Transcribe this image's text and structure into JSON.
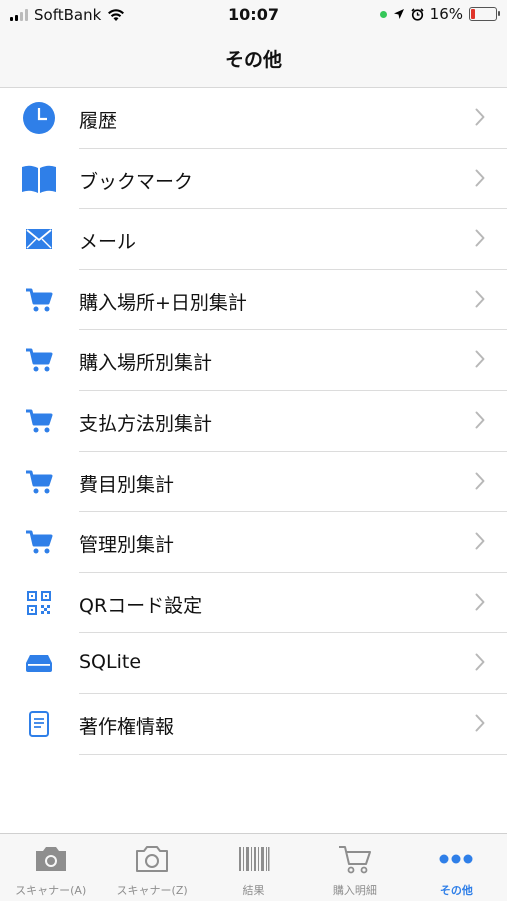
{
  "status": {
    "carrier": "SoftBank",
    "time": "10:07",
    "battery": "16%",
    "battery_level": 0.16
  },
  "nav": {
    "title": "その他"
  },
  "menu": [
    {
      "label": "履歴",
      "icon": "clock-icon"
    },
    {
      "label": "ブックマーク",
      "icon": "book-icon"
    },
    {
      "label": "メール",
      "icon": "envelope-icon"
    },
    {
      "label": "購入場所+日別集計",
      "icon": "cart-icon"
    },
    {
      "label": "購入場所別集計",
      "icon": "cart-icon"
    },
    {
      "label": "支払方法別集計",
      "icon": "cart-icon"
    },
    {
      "label": "費目別集計",
      "icon": "cart-icon"
    },
    {
      "label": "管理別集計",
      "icon": "cart-icon"
    },
    {
      "label": "QRコード設定",
      "icon": "qrcode-icon"
    },
    {
      "label": "SQLite",
      "icon": "drive-icon"
    },
    {
      "label": "著作権情報",
      "icon": "document-icon"
    }
  ],
  "tabs": [
    {
      "label": "スキャナー(A)",
      "icon": "camera-filled-icon",
      "active": false
    },
    {
      "label": "スキャナー(Z)",
      "icon": "camera-outline-icon",
      "active": false
    },
    {
      "label": "結果",
      "icon": "barcode-icon",
      "active": false
    },
    {
      "label": "購入明細",
      "icon": "cart-outline-icon",
      "active": false
    },
    {
      "label": "その他",
      "icon": "more-icon",
      "active": true
    }
  ],
  "colors": {
    "accent": "#2f7fe8",
    "inactive": "#8e8e8e"
  }
}
